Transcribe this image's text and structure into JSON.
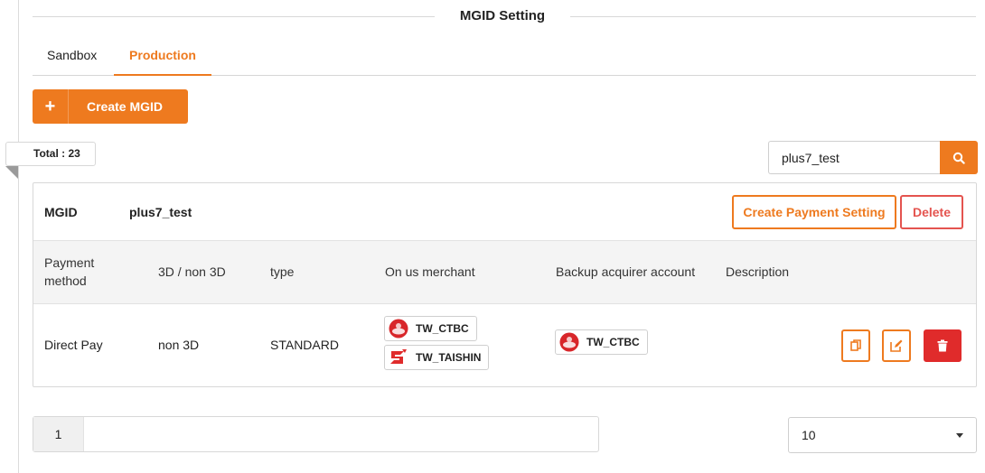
{
  "section_title": "MGID Setting",
  "tabs": [
    {
      "label": "Sandbox",
      "active": false
    },
    {
      "label": "Production",
      "active": true
    }
  ],
  "create_button": {
    "icon": "plus-icon",
    "label": "Create MGID"
  },
  "total": "Total : 23",
  "search": {
    "value": "plus7_test",
    "icon": "search-icon"
  },
  "card": {
    "mgid_label": "MGID",
    "mgid_value": "plus7_test",
    "create_payment_label": "Create Payment Setting",
    "delete_label": "Delete",
    "columns": [
      "Payment method",
      "3D / non 3D",
      "type",
      "On us merchant",
      "Backup acquirer account",
      "Description"
    ],
    "rows": [
      {
        "payment_method": "Direct Pay",
        "three_d": "non 3D",
        "type": "STANDARD",
        "on_us_merchants": [
          "TW_CTBC",
          "TW_TAISHIN"
        ],
        "backup_acquirer": "TW_CTBC",
        "description": ""
      }
    ],
    "actions": [
      "copy-icon",
      "edit-icon",
      "trash-icon"
    ]
  },
  "pagination": {
    "current_page": "1"
  },
  "page_size": "10",
  "colors": {
    "accent": "#ee7a1f",
    "danger": "#e02b2b",
    "danger_outline": "#e4544f"
  }
}
